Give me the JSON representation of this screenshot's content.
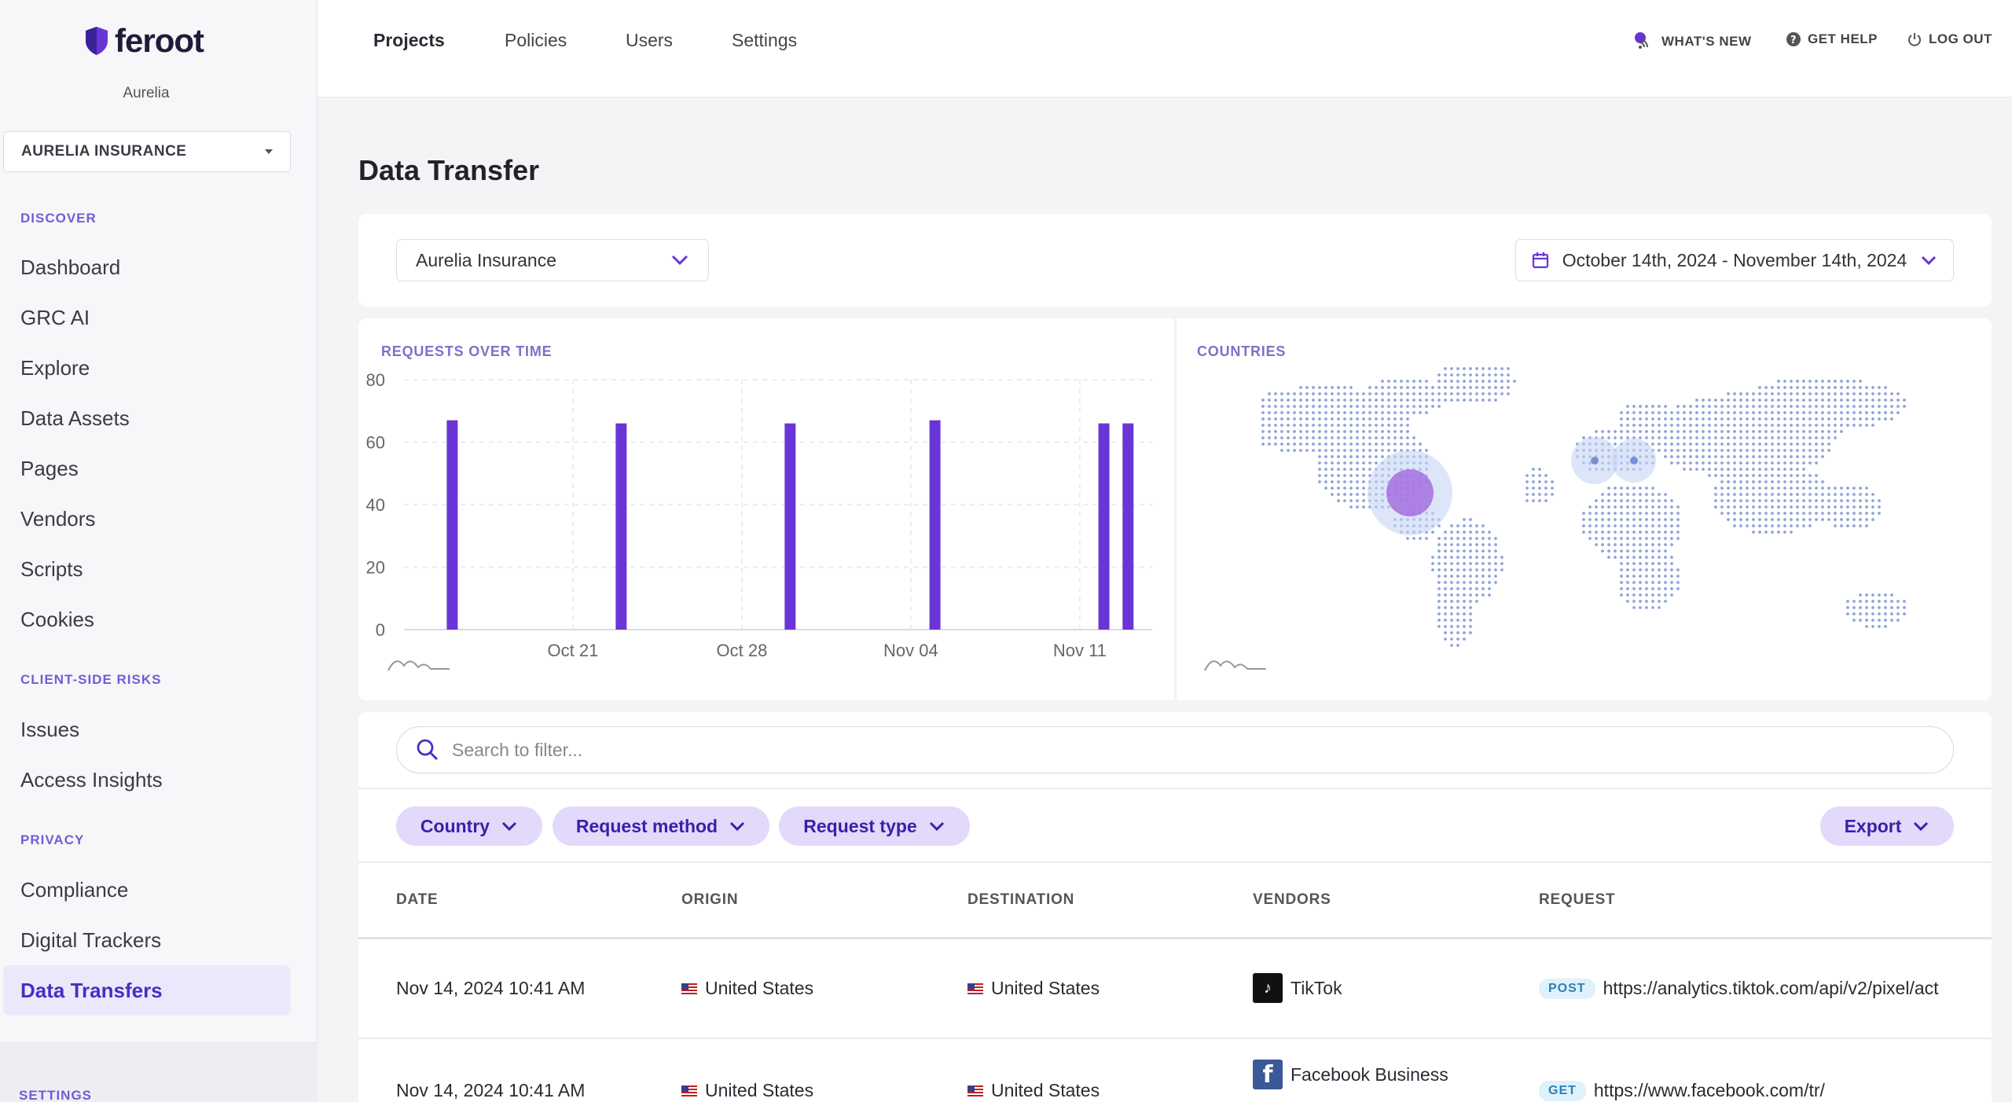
{
  "brand": {
    "name": "feroot",
    "tenant": "Aurelia",
    "org_select": "AURELIA INSURANCE"
  },
  "sidebar": {
    "sections": [
      {
        "title": "DISCOVER",
        "items": [
          "Dashboard",
          "GRC AI",
          "Explore",
          "Data Assets",
          "Pages",
          "Vendors",
          "Scripts",
          "Cookies"
        ]
      },
      {
        "title": "CLIENT-SIDE RISKS",
        "items": [
          "Issues",
          "Access Insights"
        ]
      },
      {
        "title": "PRIVACY",
        "items": [
          "Compliance",
          "Digital Trackers",
          "Data Transfers"
        ]
      }
    ],
    "active_item": "Data Transfers",
    "footer_section": "SETTINGS"
  },
  "topnav": {
    "items": [
      "Projects",
      "Policies",
      "Users",
      "Settings"
    ],
    "active": "Projects"
  },
  "toplinks": {
    "whats_new": "WHAT'S NEW",
    "get_help": "GET HELP",
    "log_out": "LOG OUT"
  },
  "page": {
    "title": "Data Transfer"
  },
  "filters": {
    "project_select": "Aurelia Insurance",
    "date_range": "October 14th, 2024 - November 14th, 2024"
  },
  "requests_chart": {
    "label": "REQUESTS OVER TIME",
    "chart_data": {
      "type": "bar",
      "x": [
        "2024-10-16",
        "2024-10-23",
        "2024-10-30",
        "2024-11-05",
        "2024-11-12",
        "2024-11-13"
      ],
      "values": [
        67,
        66,
        66,
        67,
        66,
        66
      ],
      "x_ticks": [
        "Oct 21",
        "Oct 28",
        "Nov 04",
        "Nov 11"
      ],
      "y_ticks": [
        0,
        20,
        40,
        60,
        80
      ],
      "ylim": [
        0,
        80
      ],
      "grid": true,
      "bar_color": "#6a35d6"
    }
  },
  "countries_map": {
    "label": "COUNTRIES"
  },
  "search": {
    "placeholder": "Search to filter..."
  },
  "chips": [
    "Country",
    "Request method",
    "Request type"
  ],
  "export_label": "Export",
  "table": {
    "columns": [
      "DATE",
      "ORIGIN",
      "DESTINATION",
      "VENDORS",
      "REQUEST"
    ],
    "rows": [
      {
        "date": "Nov 14, 2024 10:41 AM",
        "origin": "United States",
        "destination": "United States",
        "vendor": "TikTok",
        "vendor_icon": "tiktok-icon",
        "method": "POST",
        "url": "https://analytics.tiktok.com/api/v2/pixel/act"
      },
      {
        "date": "Nov 14, 2024 10:41 AM",
        "origin": "United States",
        "destination": "United States",
        "vendor": "Facebook Business",
        "vendor_icon": "facebook-icon",
        "method": "GET",
        "url": "https://www.facebook.com/tr/"
      }
    ]
  },
  "colors": {
    "accent": "#6a35d6",
    "accent_light": "#e2d9fb",
    "section_label": "#6d5fd6"
  }
}
